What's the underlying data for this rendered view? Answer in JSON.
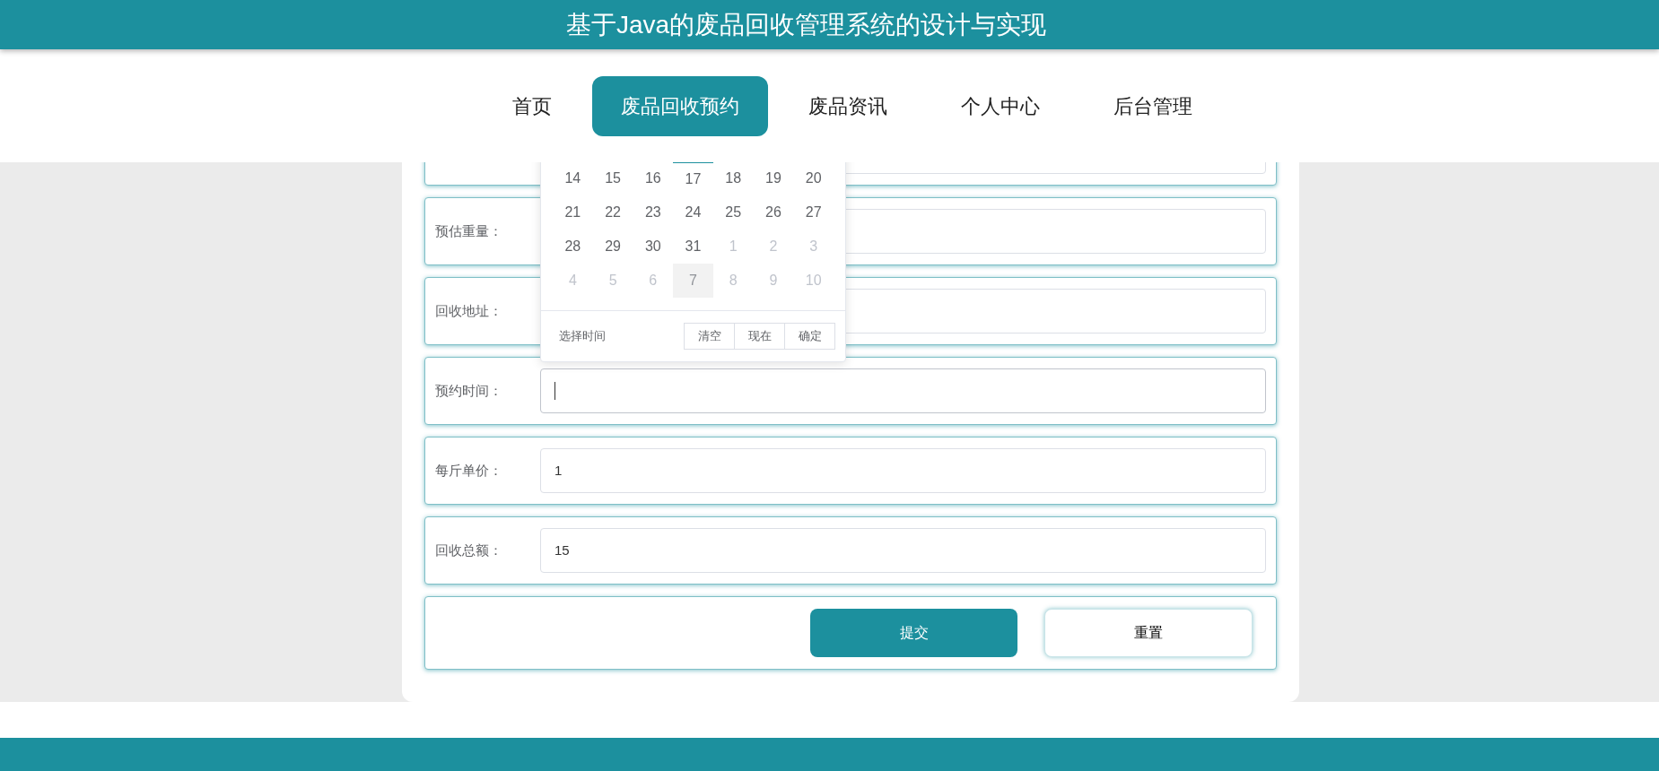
{
  "header": {
    "title": "基于Java的废品回收管理系统的设计与实现"
  },
  "nav": [
    {
      "label": "首页",
      "selected": false
    },
    {
      "label": "废品回收预约",
      "selected": true
    },
    {
      "label": "废品资讯",
      "selected": false
    },
    {
      "label": "个人中心",
      "selected": false
    },
    {
      "label": "后台管理",
      "selected": false
    }
  ],
  "form": {
    "fields": [
      {
        "label": "预估重量：",
        "focused": false
      },
      {
        "label": "回收地址：",
        "focused": false
      },
      {
        "label": "预约时间：",
        "focused": true
      },
      {
        "label": "每斤单价：",
        "value": "1",
        "focused": false
      },
      {
        "label": "回收总额：",
        "value": "15",
        "focused": false
      }
    ],
    "buttons": [
      {
        "label": "提交",
        "kind": "primary"
      },
      {
        "label": "重置",
        "kind": "secondary"
      }
    ]
  },
  "date_picker": {
    "weeks": [
      [
        {
          "day": "14",
          "outside": false,
          "today": false,
          "hovered": false
        },
        {
          "day": "15",
          "outside": false,
          "today": false,
          "hovered": false
        },
        {
          "day": "16",
          "outside": false,
          "today": false,
          "hovered": false
        },
        {
          "day": "17",
          "outside": false,
          "today": true,
          "hovered": false
        },
        {
          "day": "18",
          "outside": false,
          "today": false,
          "hovered": false
        },
        {
          "day": "19",
          "outside": false,
          "today": false,
          "hovered": false
        },
        {
          "day": "20",
          "outside": false,
          "today": false,
          "hovered": false
        }
      ],
      [
        {
          "day": "21",
          "outside": false,
          "today": false,
          "hovered": false
        },
        {
          "day": "22",
          "outside": false,
          "today": false,
          "hovered": false
        },
        {
          "day": "23",
          "outside": false,
          "today": false,
          "hovered": false
        },
        {
          "day": "24",
          "outside": false,
          "today": false,
          "hovered": false
        },
        {
          "day": "25",
          "outside": false,
          "today": false,
          "hovered": false
        },
        {
          "day": "26",
          "outside": false,
          "today": false,
          "hovered": false
        },
        {
          "day": "27",
          "outside": false,
          "today": false,
          "hovered": false
        }
      ],
      [
        {
          "day": "28",
          "outside": false,
          "today": false,
          "hovered": false
        },
        {
          "day": "29",
          "outside": false,
          "today": false,
          "hovered": false
        },
        {
          "day": "30",
          "outside": false,
          "today": false,
          "hovered": false
        },
        {
          "day": "31",
          "outside": false,
          "today": false,
          "hovered": false
        },
        {
          "day": "1",
          "outside": true,
          "today": false,
          "hovered": false
        },
        {
          "day": "2",
          "outside": true,
          "today": false,
          "hovered": false
        },
        {
          "day": "3",
          "outside": true,
          "today": false,
          "hovered": false
        }
      ],
      [
        {
          "day": "4",
          "outside": true,
          "today": false,
          "hovered": false
        },
        {
          "day": "5",
          "outside": true,
          "today": false,
          "hovered": false
        },
        {
          "day": "6",
          "outside": true,
          "today": false,
          "hovered": false
        },
        {
          "day": "7",
          "outside": true,
          "today": false,
          "hovered": true
        },
        {
          "day": "8",
          "outside": true,
          "today": false,
          "hovered": false
        },
        {
          "day": "9",
          "outside": true,
          "today": false,
          "hovered": false
        },
        {
          "day": "10",
          "outside": true,
          "today": false,
          "hovered": false
        }
      ]
    ],
    "footer_label": "选择时间",
    "buttons": [
      "清空",
      "现在",
      "确定"
    ]
  }
}
